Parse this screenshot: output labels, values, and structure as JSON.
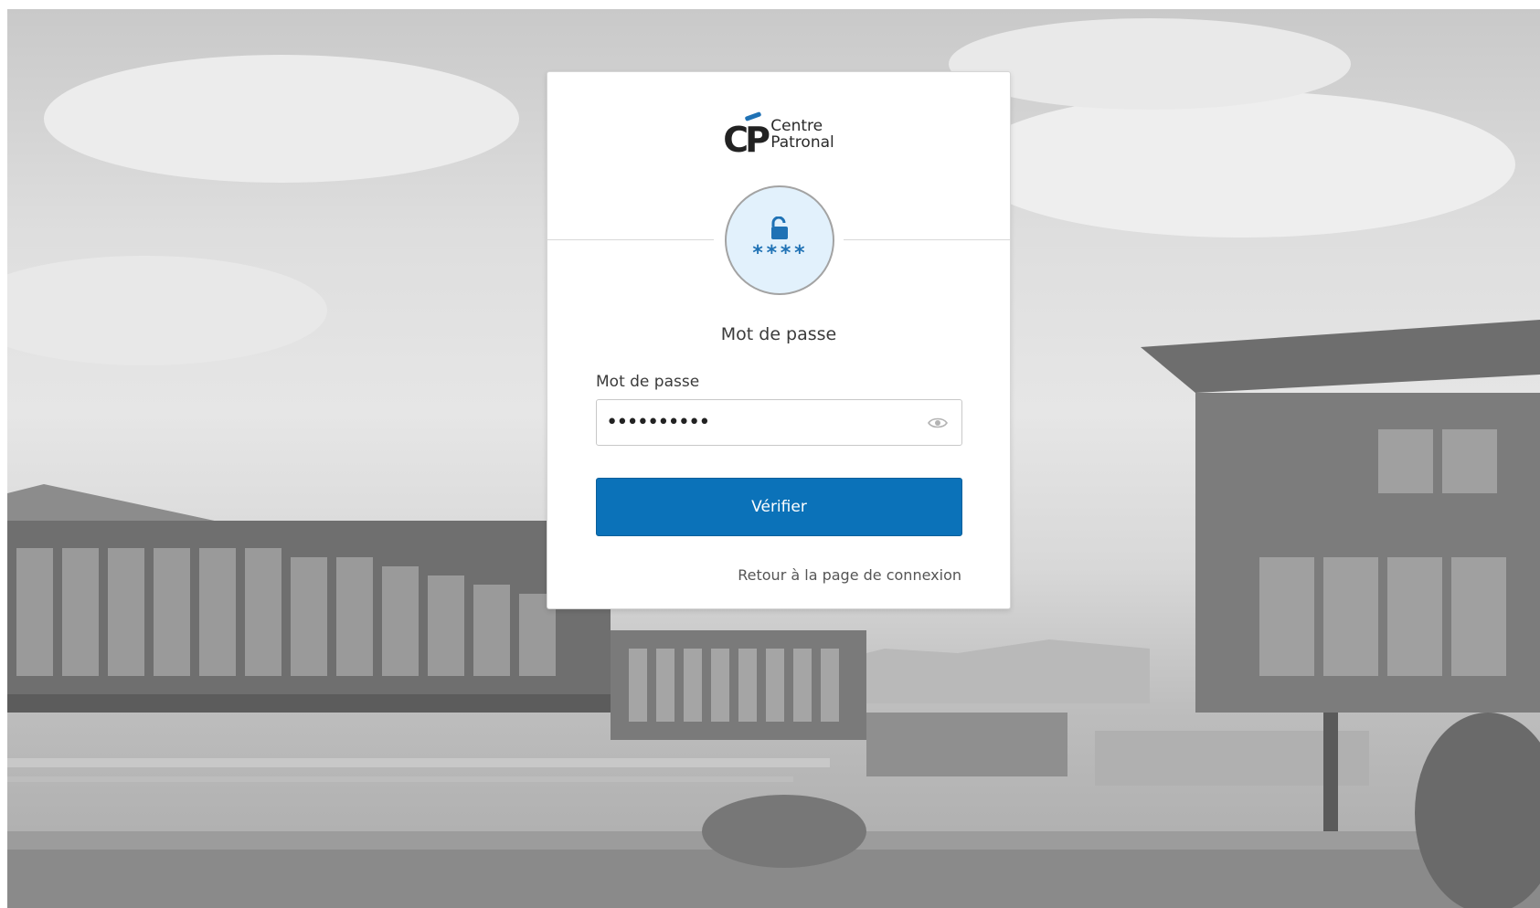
{
  "logo": {
    "line1": "Centre",
    "line2": "Patronal",
    "mark": "CP"
  },
  "badge": {
    "icon": "unlocked-padlock-icon",
    "stars": "****"
  },
  "form": {
    "title": "Mot de passe",
    "password_label": "Mot de passe",
    "password_value": "••••••••••",
    "reveal_icon": "eye-icon",
    "verify_label": "Vérifier",
    "back_link": "Retour à la page de connexion"
  },
  "colors": {
    "brand_blue": "#0b72b9",
    "badge_bg": "#e2f1fc"
  }
}
